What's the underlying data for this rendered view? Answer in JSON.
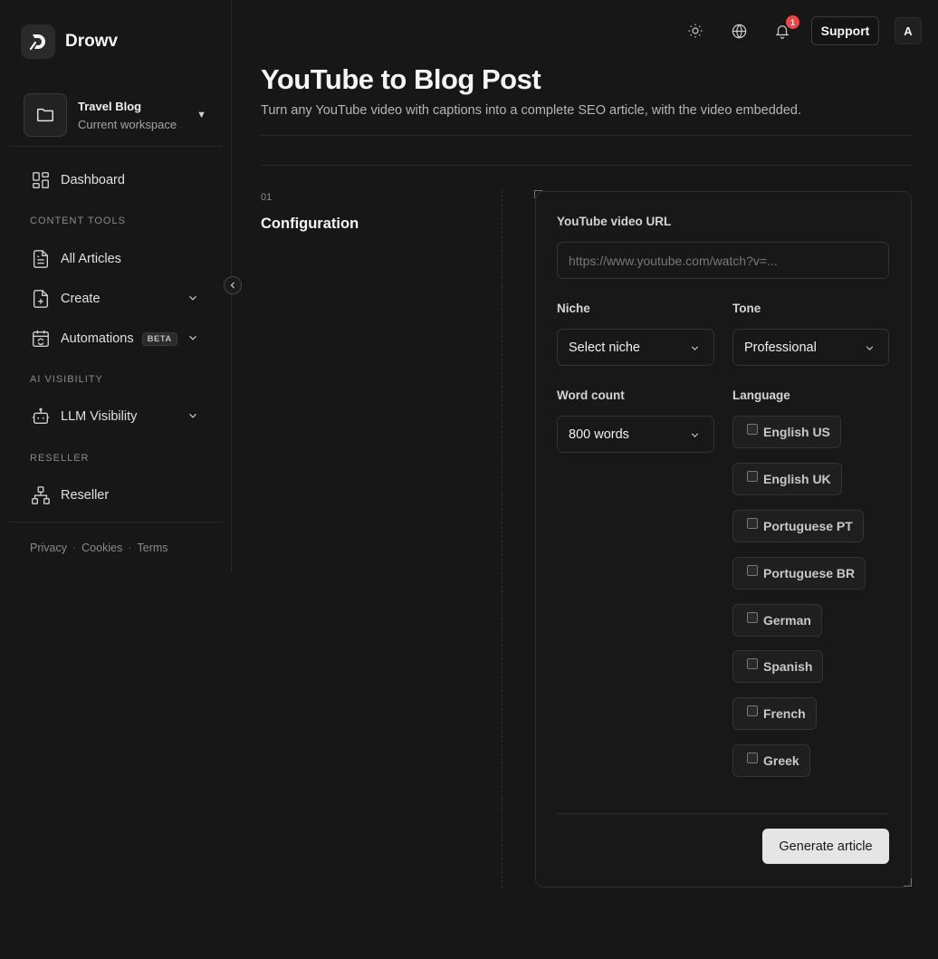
{
  "brand": {
    "name": "Drowv"
  },
  "workspace": {
    "name": "Travel Blog",
    "subtitle": "Current workspace"
  },
  "sidebar": {
    "items": [
      {
        "label": "Dashboard"
      },
      {
        "label": "All Articles"
      },
      {
        "label": "Create"
      },
      {
        "label": "Automations",
        "badge": "BETA"
      },
      {
        "label": "LLM Visibility"
      },
      {
        "label": "Reseller"
      }
    ],
    "sections": {
      "content_tools": "CONTENT TOOLS",
      "ai_visibility": "AI VISIBILITY",
      "reseller": "RESELLER"
    },
    "footer": {
      "privacy": "Privacy",
      "cookies": "Cookies",
      "terms": "Terms",
      "separator": "·"
    }
  },
  "header": {
    "notification_count": "1",
    "support_label": "Support",
    "avatar_initial": "A"
  },
  "page": {
    "title": "YouTube to Blog Post",
    "subtitle": "Turn any YouTube video with captions into a complete SEO article, with the video embedded."
  },
  "step": {
    "number": "01",
    "title": "Configuration"
  },
  "form": {
    "url_label": "YouTube video URL",
    "url_placeholder": "https://www.youtube.com/watch?v=...",
    "url_value": "",
    "niche_label": "Niche",
    "niche_value": "Select niche",
    "tone_label": "Tone",
    "tone_value": "Professional",
    "word_count_label": "Word count",
    "word_count_value": "800 words",
    "language_label": "Language",
    "languages": [
      "English US",
      "English UK",
      "Portuguese PT",
      "Portuguese BR",
      "German",
      "Spanish",
      "French",
      "Greek"
    ],
    "generate_label": "Generate article"
  },
  "colors": {
    "background": "#171717",
    "notification": "#ef4444",
    "primary_button": "#e5e5e5"
  }
}
